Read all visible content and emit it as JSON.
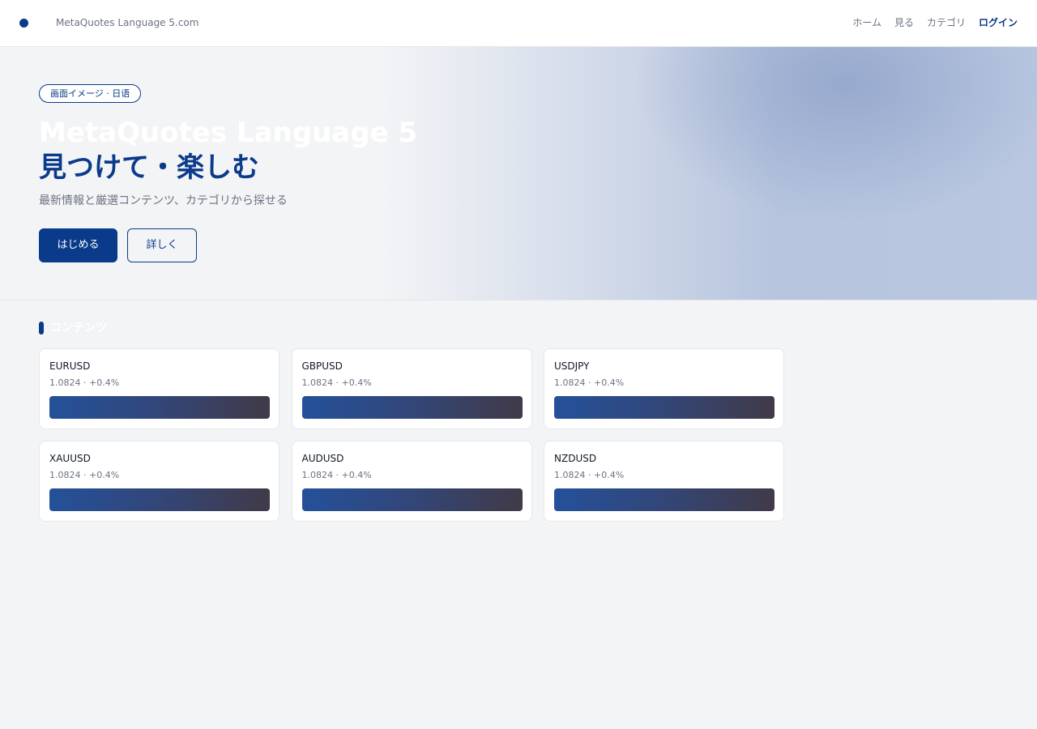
{
  "header": {
    "brand_name": "MetaQuotes Language 5.com",
    "nav": [
      {
        "label": "ホーム"
      },
      {
        "label": "見る"
      },
      {
        "label": "カテゴリ"
      },
      {
        "label": "ログイン"
      }
    ]
  },
  "hero": {
    "badge": "画面イメージ · 日语",
    "title_line1": "MetaQuotes Language 5",
    "title_line2": "見つけて・楽しむ",
    "subtitle": "最新情報と厳選コンテンツ、カテゴリから探せる",
    "primary_button": "はじめる",
    "secondary_button": "詳しく"
  },
  "section": {
    "title": "コンテンツ"
  },
  "cards": [
    {
      "symbol": "EURUSD",
      "quote": "1.0824 · +0.4%"
    },
    {
      "symbol": "GBPUSD",
      "quote": "1.0824 · +0.4%"
    },
    {
      "symbol": "USDJPY",
      "quote": "1.0824 · +0.4%"
    },
    {
      "symbol": "XAUUSD",
      "quote": "1.0824 · +0.4%"
    },
    {
      "symbol": "AUDUSD",
      "quote": "1.0824 · +0.4%"
    },
    {
      "symbol": "NZDUSD",
      "quote": "1.0824 · +0.4%"
    }
  ],
  "colors": {
    "accent": "#0a3a8a",
    "background": "#f3f4f6",
    "card_background": "#ffffff"
  },
  "icons": {
    "brand": "brand-dot-icon"
  }
}
